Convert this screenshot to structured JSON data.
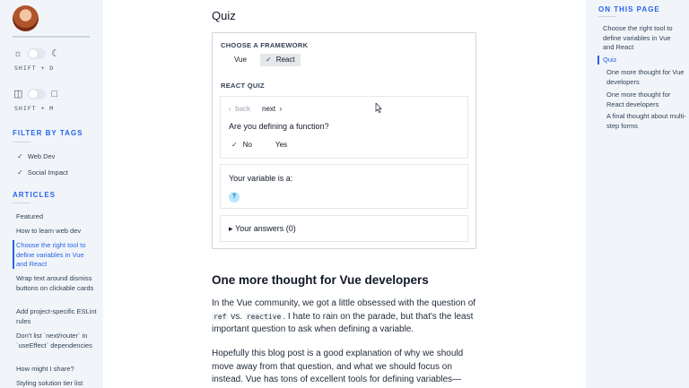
{
  "sidebar": {
    "theme_shortcut": "SHIFT + D",
    "layout_shortcut": "SHIFT + M",
    "filter_heading": "FILTER BY TAGS",
    "tags": [
      {
        "label": "Web Dev",
        "checked": true
      },
      {
        "label": "Social Impact",
        "checked": true
      }
    ],
    "articles_heading": "ARTICLES",
    "articles": [
      {
        "label": "Featured"
      },
      {
        "label": "How to learn web dev"
      },
      {
        "label": "Choose the right tool to define variables in Vue and React",
        "active": true
      },
      {
        "label": "Wrap text around dismiss buttons on clickable cards"
      },
      {
        "label": "Add project-specific ESLint rules"
      },
      {
        "label": "Don't list `next/router` in `useEffect` dependencies"
      },
      {
        "label": "How might I share?"
      },
      {
        "label": "Styling solution tier list"
      }
    ]
  },
  "main": {
    "title": "Quiz",
    "framework_label": "CHOOSE A FRAMEWORK",
    "frameworks": [
      {
        "label": "Vue",
        "selected": false
      },
      {
        "label": "React",
        "selected": true
      }
    ],
    "quiz_label": "REACT QUIZ",
    "nav_back": "back",
    "nav_next": "next",
    "question": "Are you defining a function?",
    "answers": [
      {
        "label": "No",
        "selected": true
      },
      {
        "label": "Yes",
        "selected": false
      }
    ],
    "variable_label": "Your variable is a:",
    "variable_value": "?",
    "your_answers": "Your answers (0)",
    "section_heading": "One more thought for Vue developers",
    "para1_a": "In the Vue community, we got a little obsessed with the question of",
    "para1_code1": "ref",
    "para1_vs": "vs.",
    "para1_code2": "reactive",
    "para1_b": ". I hate to rain on the parade, but that's the least important question to ask when defining a variable.",
    "para2": "Hopefully this blog post is a good explanation of why we should move away from that question, and what we should focus on instead. Vue has tons of excellent tools for defining variables—take"
  },
  "toc": {
    "heading": "ON THIS PAGE",
    "items": [
      {
        "label": "Choose the right tool to define variables in Vue and React"
      },
      {
        "label": "Quiz",
        "active": true
      },
      {
        "label": "One more thought for Vue developers"
      },
      {
        "label": "One more thought for React developers"
      },
      {
        "label": "A final thought about multi-step forms"
      }
    ]
  },
  "colors": {
    "accent": "#2563eb",
    "sidebar_bg": "#f1f5f9"
  }
}
